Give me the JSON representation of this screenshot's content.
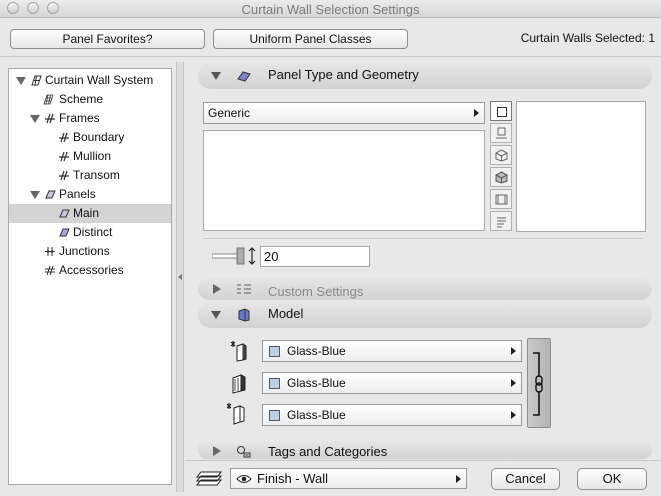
{
  "window": {
    "title": "Curtain Wall Selection Settings"
  },
  "toolbar": {
    "panel_favorites": "Panel Favorites?",
    "uniform_panel_classes": "Uniform Panel Classes",
    "selected_status": "Curtain Walls Selected: 1"
  },
  "tree": {
    "items": [
      {
        "label": "Curtain Wall System",
        "icon": "curtain-wall-icon"
      },
      {
        "label": "Scheme",
        "icon": "scheme-grid-icon"
      },
      {
        "label": "Frames",
        "icon": "frames-icon"
      },
      {
        "label": "Boundary",
        "icon": "frame-icon"
      },
      {
        "label": "Mullion",
        "icon": "frame-icon"
      },
      {
        "label": "Transom",
        "icon": "frame-icon"
      },
      {
        "label": "Panels",
        "icon": "panels-icon"
      },
      {
        "label": "Main",
        "icon": "panel-icon"
      },
      {
        "label": "Distinct",
        "icon": "panel-icon"
      },
      {
        "label": "Junctions",
        "icon": "junctions-icon"
      },
      {
        "label": "Accessories",
        "icon": "accessories-icon"
      }
    ],
    "selected": "Main"
  },
  "sections": {
    "panel_type": {
      "title": "Panel Type and Geometry",
      "type_value": "Generic",
      "thickness_value": "20"
    },
    "custom": {
      "title": "Custom Settings"
    },
    "model": {
      "title": "Model",
      "surfaces": [
        {
          "value": "Glass-Blue",
          "icon": "outer-surface-icon"
        },
        {
          "value": "Glass-Blue",
          "icon": "edge-surface-icon"
        },
        {
          "value": "Glass-Blue",
          "icon": "inner-surface-icon"
        }
      ],
      "link_icon": "chain-link-icon"
    },
    "tags": {
      "title": "Tags and Categories"
    }
  },
  "footer": {
    "layer_value": "Finish - Wall",
    "cancel_label": "Cancel",
    "ok_label": "OK"
  },
  "colors": {
    "swatch": "#bcd0e0",
    "selected_row": "#d4d4d4"
  }
}
